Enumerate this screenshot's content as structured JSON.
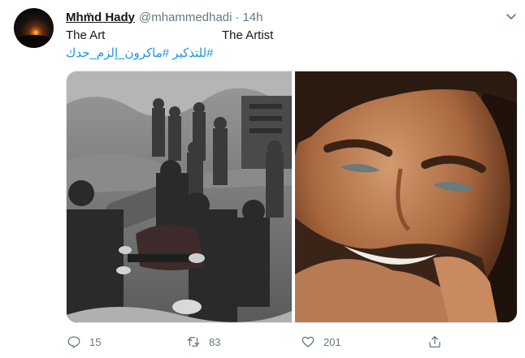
{
  "tweet": {
    "author_name": "Mhm̈d Hady",
    "handle": "@mhammedhadi",
    "separator": "·",
    "time": "14h",
    "text_left": "The Art",
    "text_right": "The Artist",
    "hashtags": "#للتذكير #ماكرون_إلزم_حدك"
  },
  "media": {
    "left_image": "soldiers-carrying-body-photo",
    "right_image": "smiling-man-portrait-photo"
  },
  "actions": {
    "reply_count": "15",
    "retweet_count": "83",
    "like_count": "201"
  },
  "icons": [
    "chevron-down-icon",
    "reply-icon",
    "retweet-icon",
    "like-icon",
    "share-icon"
  ],
  "colors": {
    "link": "#1b95e0",
    "secondary": "#657786",
    "text": "#14171a"
  }
}
